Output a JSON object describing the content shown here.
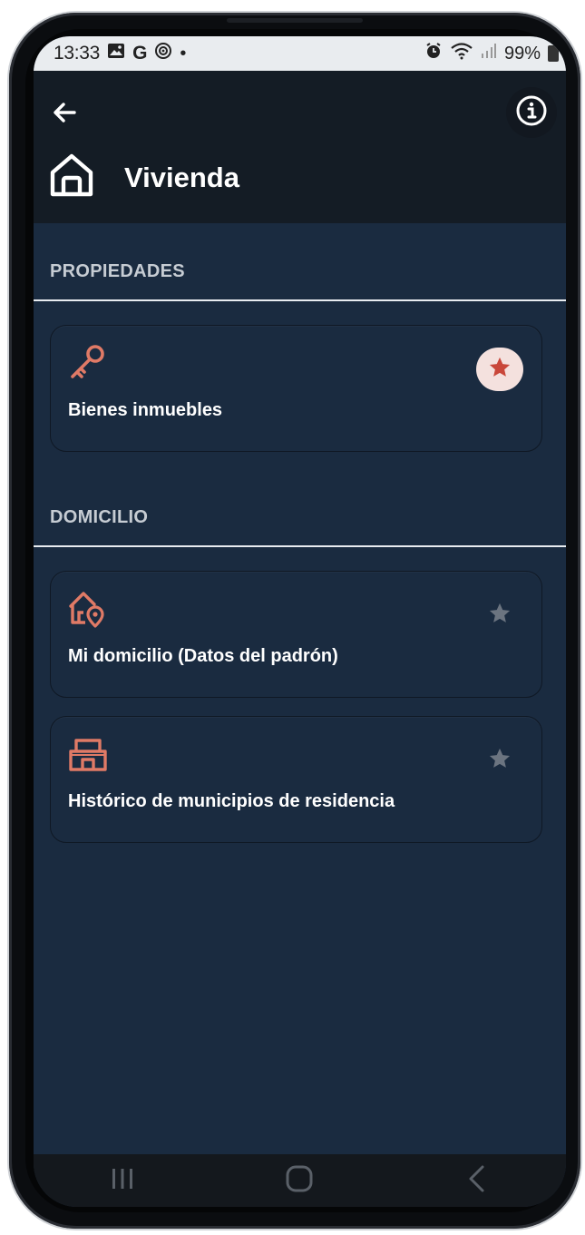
{
  "status_bar": {
    "time": "13:33",
    "google_letter": "G",
    "dot": "•",
    "battery": "99%"
  },
  "header": {
    "title": "Vivienda",
    "title_icon": "house-icon",
    "back_icon": "arrow-left-icon",
    "info_icon": "info-icon"
  },
  "sections": [
    {
      "title": "PROPIEDADES",
      "items": [
        {
          "label": "Bienes inmuebles",
          "icon": "key-icon",
          "favorite": true
        }
      ]
    },
    {
      "title": "DOMICILIO",
      "items": [
        {
          "label": "Mi domicilio (Datos del padrón)",
          "icon": "house-location-icon",
          "favorite": false
        },
        {
          "label": "Histórico de municipios de residencia",
          "icon": "building-icon",
          "favorite": false
        }
      ]
    }
  ],
  "colors": {
    "accent": "#e07a66",
    "star_active": "#c9473a",
    "star_inactive": "#6b7480",
    "background": "#1a2b40",
    "header": "#141c25"
  },
  "nav_bar": {
    "recents_icon": "recents-icon",
    "home_icon": "home-nav-icon",
    "back_icon": "back-nav-icon"
  }
}
